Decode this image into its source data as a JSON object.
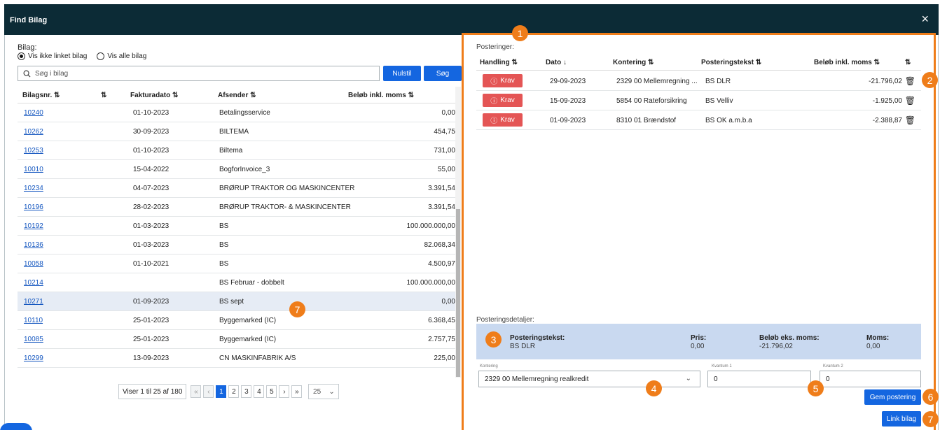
{
  "window": {
    "title": "Find Bilag",
    "close_glyph": "×"
  },
  "filter": {
    "label": "Bilag:",
    "options": [
      {
        "label": "Vis ikke linket bilag",
        "selected": true
      },
      {
        "label": "Vis alle bilag",
        "selected": false
      }
    ]
  },
  "search": {
    "placeholder": "Søg i bilag",
    "icon": "search-icon"
  },
  "buttons": {
    "nulstil": "Nulstil",
    "sog": "Søg",
    "gem_postering": "Gem postering",
    "link_bilag": "Link bilag"
  },
  "bilag_table": {
    "columns": [
      "Bilagsnr. ⇅",
      "⇅",
      "Fakturadato ⇅",
      "Afsender ⇅",
      "Beløb inkl. moms ⇅"
    ],
    "rows": [
      {
        "nr": "10240",
        "dato": "01-10-2023",
        "afsender": "Betalingsservice",
        "belob": "0,00"
      },
      {
        "nr": "10262",
        "dato": "30-09-2023",
        "afsender": "BILTEMA",
        "belob": "454,75"
      },
      {
        "nr": "10253",
        "dato": "01-10-2023",
        "afsender": "Biltema",
        "belob": "731,00"
      },
      {
        "nr": "10010",
        "dato": "15-04-2022",
        "afsender": "BogforInvoice_3",
        "belob": "55,00"
      },
      {
        "nr": "10234",
        "dato": "04-07-2023",
        "afsender": "BRØRUP TRAKTOR OG MASKINCENTER",
        "belob": "3.391,54"
      },
      {
        "nr": "10196",
        "dato": "28-02-2023",
        "afsender": "BRØRUP TRAKTOR- & MASKINCENTER",
        "belob": "3.391,54"
      },
      {
        "nr": "10192",
        "dato": "01-03-2023",
        "afsender": "BS",
        "belob": "100.000.000,00"
      },
      {
        "nr": "10136",
        "dato": "01-03-2023",
        "afsender": "BS",
        "belob": "82.068,34"
      },
      {
        "nr": "10058",
        "dato": "01-10-2021",
        "afsender": "BS",
        "belob": "4.500,97"
      },
      {
        "nr": "10214",
        "dato": "",
        "afsender": "BS Februar - dobbelt",
        "belob": "100.000.000,00"
      },
      {
        "nr": "10271",
        "dato": "01-09-2023",
        "afsender": "BS sept",
        "belob": "0,00"
      },
      {
        "nr": "10110",
        "dato": "25-01-2023",
        "afsender": "Byggemarked (IC)",
        "belob": "6.368,45"
      },
      {
        "nr": "10085",
        "dato": "25-01-2023",
        "afsender": "Byggemarked (IC)",
        "belob": "2.757,75"
      },
      {
        "nr": "10299",
        "dato": "13-09-2023",
        "afsender": "CN MASKINFABRIK A/S",
        "belob": "225,00"
      }
    ],
    "selected_row": "10271"
  },
  "pagination": {
    "info": "Viser 1 til 25 af 180",
    "first": "«",
    "prev": "‹",
    "pages": [
      "1",
      "2",
      "3",
      "4",
      "5"
    ],
    "current": "1",
    "next": "›",
    "last": "»",
    "page_size": "25",
    "size_chevron": "⌄"
  },
  "posteringer": {
    "label": "Posteringer:",
    "columns": [
      "Handling ⇅",
      "Dato ↓",
      "Kontering ⇅",
      "Posteringstekst ⇅",
      "Beløb inkl. moms ⇅",
      "⇅"
    ],
    "rows": [
      {
        "handling": "Krav",
        "dato": "29-09-2023",
        "kontering": "2329 00 Mellemregning ...",
        "tekst": "BS DLR",
        "belob": "-21.796,02"
      },
      {
        "handling": "Krav",
        "dato": "15-09-2023",
        "kontering": "5854 00 Rateforsikring",
        "tekst": "BS Velliv",
        "belob": "-1.925,00"
      },
      {
        "handling": "Krav",
        "dato": "01-09-2023",
        "kontering": "8310 01 Brændstof",
        "tekst": "BS OK a.m.b.a",
        "belob": "-2.388,87"
      }
    ],
    "krav_icon": "ⓘ",
    "delete_icon": "🗑"
  },
  "detaljer": {
    "label": "Posteringsdetaljer:",
    "posteringstekst_label": "Posteringstekst:",
    "posteringstekst": "BS DLR",
    "pris_label": "Pris:",
    "pris": "0,00",
    "belob_label": "Beløb eks. moms:",
    "belob": "-21.796,02",
    "moms_label": "Moms:",
    "moms": "0,00"
  },
  "form": {
    "kontering_label": "Kontering",
    "kontering_value": "2329 00 Mellemregning realkredit",
    "kvantum1_label": "Kvantum 1",
    "kvantum1_value": "0",
    "kvantum2_label": "Kvantum 2",
    "kvantum2_value": "0"
  },
  "annotations": [
    "1",
    "2",
    "3",
    "4",
    "5",
    "6",
    "7",
    "7"
  ],
  "colors": {
    "header": "#0c2b36",
    "accent": "#1466e0",
    "annotation": "#ef7d1a",
    "krav": "#e45555",
    "detail_bg": "#c9d9f0"
  }
}
